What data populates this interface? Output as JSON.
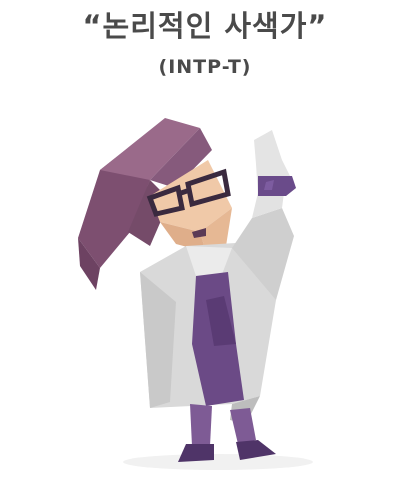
{
  "header": {
    "title": "“논리적인 사색가”",
    "subtitle": "(INTP-T)"
  },
  "illustration": {
    "name": "scientist-with-flask",
    "colors": {
      "hair": "#8a5a7a",
      "coat": "#d9d9d9",
      "dress": "#6b4a86",
      "skin": "#f0c9a8",
      "glasses": "#3a2a3f",
      "liquid": "#6a4b8a"
    }
  }
}
